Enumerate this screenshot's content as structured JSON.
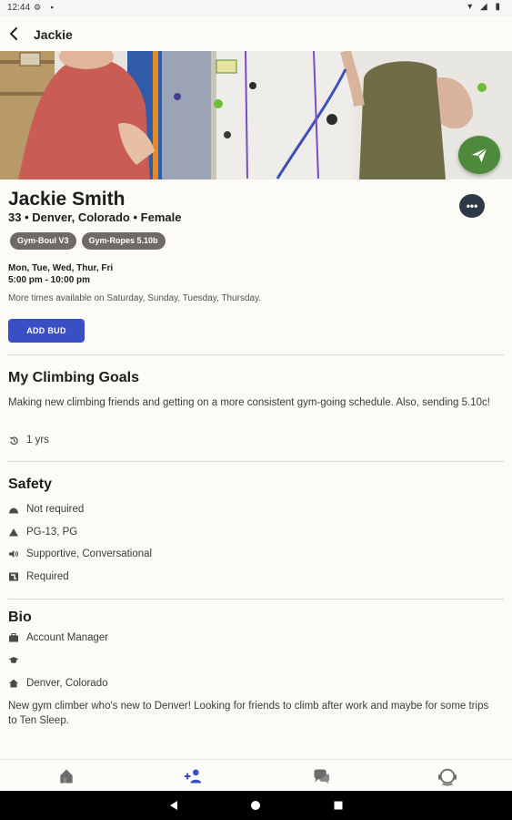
{
  "status_bar": {
    "time": "12:44"
  },
  "app_bar": {
    "title": "Jackie"
  },
  "profile": {
    "name": "Jackie Smith",
    "details": "33 • Denver, Colorado • Female",
    "chips": [
      "Gym-Boul V3",
      "Gym-Ropes 5.10b"
    ],
    "days": "Mon, Tue, Wed, Thur, Fri",
    "hours": "5:00 pm - 10:00 pm",
    "more_times": "More times available on Saturday, Sunday, Tuesday, Thursday.",
    "add_bud_label": "ADD BUD",
    "more_label": "•••"
  },
  "goals": {
    "title": "My Climbing Goals",
    "text": "Making new climbing friends and getting on a more consistent gym-going schedule. Also, sending 5.10c!",
    "experience": "1 yrs"
  },
  "safety": {
    "title": "Safety",
    "items": [
      {
        "icon": "helmet-icon",
        "text": "Not required"
      },
      {
        "icon": "mountain-icon",
        "text": "PG-13, PG"
      },
      {
        "icon": "speaker-icon",
        "text": "Supportive, Conversational"
      },
      {
        "icon": "belay-icon",
        "text": "Required"
      }
    ]
  },
  "bio": {
    "title": "Bio",
    "job": "Account Manager",
    "education": "",
    "home": "Denver, Colorado",
    "text": "New gym climber who's new to Denver! Looking for friends to climb after work and maybe for some trips to Ten Sleep."
  },
  "bottom_nav": [
    "home-icon",
    "add-person-icon",
    "chat-icon",
    "support-icon"
  ],
  "colors": {
    "accent_blue": "#3b4fc5",
    "fab_green": "#4d8a3c",
    "chip_gray": "#6f6a65",
    "background": "#fcfbf6"
  }
}
